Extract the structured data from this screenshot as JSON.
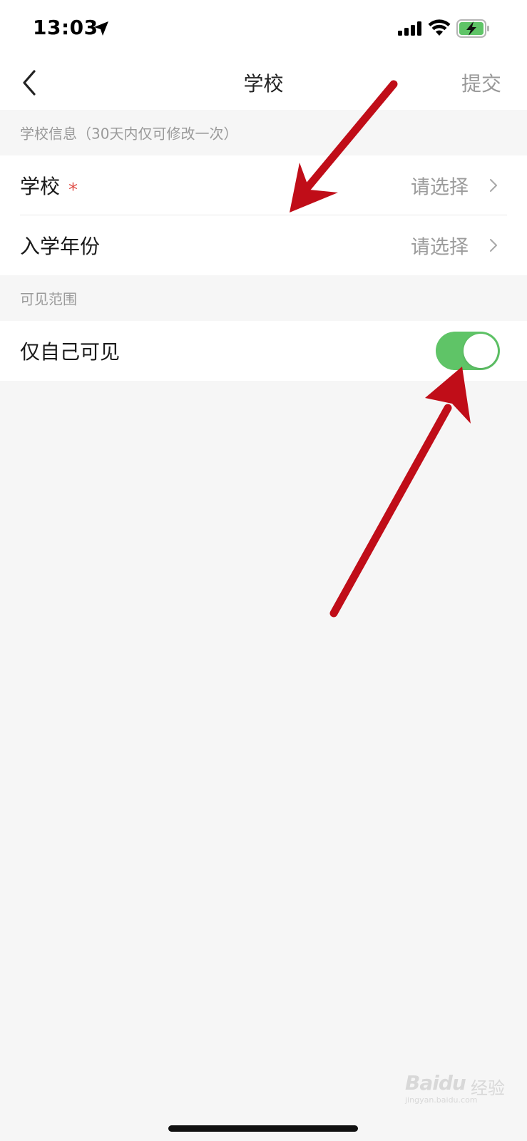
{
  "status_bar": {
    "time": "13:03",
    "icons": [
      "location-arrow-icon",
      "cellular-signal-icon",
      "wifi-icon",
      "battery-charging-icon"
    ]
  },
  "nav": {
    "back_icon": "chevron-left-icon",
    "title": "学校",
    "submit_label": "提交"
  },
  "sections": {
    "school_info_header": "学校信息（30天内仅可修改一次）",
    "visibility_header": "可见范围"
  },
  "rows": {
    "school": {
      "label": "学校",
      "required_mark": "*",
      "value": "请选择"
    },
    "enrollment_year": {
      "label": "入学年份",
      "value": "请选择"
    },
    "only_me": {
      "label": "仅自己可见",
      "toggle_on": true
    }
  },
  "colors": {
    "toggle_on": "#5fc467",
    "required": "#e0514a",
    "annotation_arrow": "#c00d18",
    "page_bg": "#f6f6f6"
  },
  "watermark": {
    "logo": "Baidu",
    "suffix": "经验",
    "url": "jingyan.baidu.com"
  }
}
